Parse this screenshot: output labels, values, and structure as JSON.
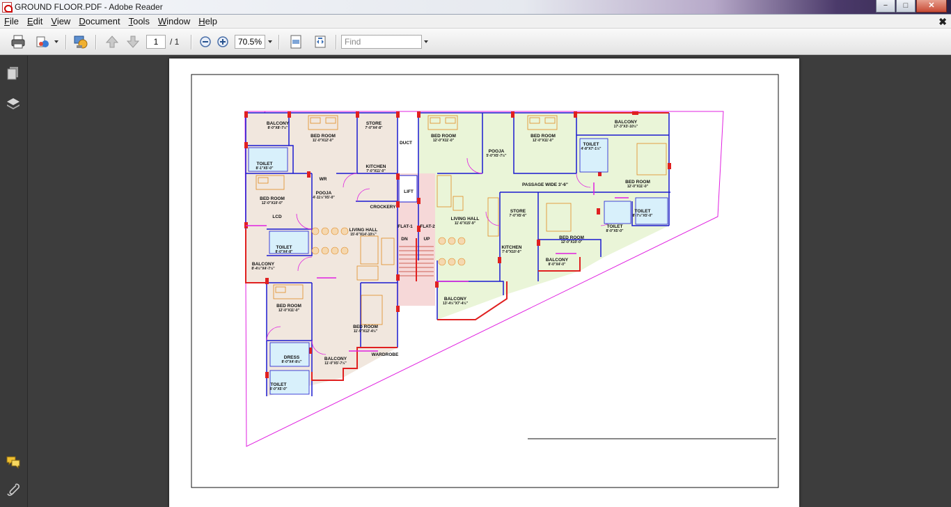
{
  "window": {
    "title": "GROUND FLOOR.PDF - Adobe Reader",
    "minimize": "−",
    "maximize": "□",
    "close": "✕"
  },
  "menu": [
    "File",
    "Edit",
    "View",
    "Document",
    "Tools",
    "Window",
    "Help"
  ],
  "doc_close": "✖",
  "toolbar": {
    "page_current": "1",
    "page_total": "/ 1",
    "zoom": "70.5%",
    "find_placeholder": "Find",
    "icons": [
      "print-icon",
      "share-icon",
      "collaborate-icon",
      "previous-page-icon",
      "next-page-icon",
      "zoom-out-icon",
      "zoom-in-icon",
      "fit-page-icon",
      "fit-width-icon"
    ]
  },
  "nav_panel": {
    "icons": [
      "pages-icon",
      "layers-icon",
      "comments-icon",
      "attachments-icon"
    ]
  },
  "colors": {
    "wall": "#1a1ad0",
    "column": "#e02020",
    "outline": "#e020e0",
    "furniture": "#e08a20",
    "floor": "#f1e7de",
    "green": "#eaf5d8"
  },
  "plan": {
    "labels": [
      {
        "name": "BALCONY",
        "dim": "8'-0\"X8'-7½\""
      },
      {
        "name": "BED ROOM",
        "dim": "11'-0\"X12'-0\""
      },
      {
        "name": "STORE",
        "dim": "7'-0\"X4'-8\""
      },
      {
        "name": "DUCT",
        "dim": ""
      },
      {
        "name": "TOILET",
        "dim": "8'-1\"X5'-0\""
      },
      {
        "name": "KITCHEN",
        "dim": "7'-0\"X11'-0\""
      },
      {
        "name": "WR",
        "dim": ""
      },
      {
        "name": "POOJA",
        "dim": "4'-11½\"X5'-0\""
      },
      {
        "name": "BED ROOM",
        "dim": "12'-0\"X10'-0\""
      },
      {
        "name": "LCD",
        "dim": ""
      },
      {
        "name": "CROCKERY",
        "dim": ""
      },
      {
        "name": "LIVING HALL",
        "dim": "15'-6\"X14'-10½\""
      },
      {
        "name": "TOILET",
        "dim": "8'-0\"X4'-8\""
      },
      {
        "name": "BALCONY",
        "dim": "8'-4½\"X4'-7½\""
      },
      {
        "name": "BED ROOM",
        "dim": "12'-0\"X11'-0\""
      },
      {
        "name": "BED ROOM",
        "dim": "11'-9\"X12'-4½\""
      },
      {
        "name": "DRESS",
        "dim": "8'-0\"X4'-8½\""
      },
      {
        "name": "BALCONY",
        "dim": "11'-0\"X5'-7½\""
      },
      {
        "name": "WARDROBE",
        "dim": ""
      },
      {
        "name": "TOILET",
        "dim": "8'-0\"X5'-0\""
      },
      {
        "name": "LIFT",
        "dim": ""
      },
      {
        "name": "FLAT-1",
        "dim": ""
      },
      {
        "name": "FLAT-2",
        "dim": ""
      },
      {
        "name": "DN",
        "dim": ""
      },
      {
        "name": "UP",
        "dim": ""
      },
      {
        "name": "BED ROOM",
        "dim": "12'-0\"X11'-0\""
      },
      {
        "name": "POOJA",
        "dim": "5'-0\"X5'-7½\""
      },
      {
        "name": "BED ROOM",
        "dim": "12'-0\"X11'-0\""
      },
      {
        "name": "BALCONY",
        "dim": "17'-3\"X3'-10½\""
      },
      {
        "name": "TOILET",
        "dim": "4'-8\"X7'-1½\""
      },
      {
        "name": "PASSAGE WIDE 3'-6\"",
        "dim": ""
      },
      {
        "name": "BED ROOM",
        "dim": "12'-0\"X11'-0\""
      },
      {
        "name": "LIVING HALL",
        "dim": "11'-6\"X15'-9\""
      },
      {
        "name": "STORE",
        "dim": "7'-0\"X5'-6\""
      },
      {
        "name": "TOILET",
        "dim": "8'-7½\"X5'-0\""
      },
      {
        "name": "TOILET",
        "dim": "8'-0\"X5'-0\""
      },
      {
        "name": "KITCHEN",
        "dim": "7'-0\"X10'-0\""
      },
      {
        "name": "BED ROOM",
        "dim": "12'-0\"X10'-0\""
      },
      {
        "name": "BALCONY",
        "dim": "8'-0\"X4'-0\""
      },
      {
        "name": "BALCONY",
        "dim": "13'-4½\"X7'-4½\""
      }
    ]
  }
}
